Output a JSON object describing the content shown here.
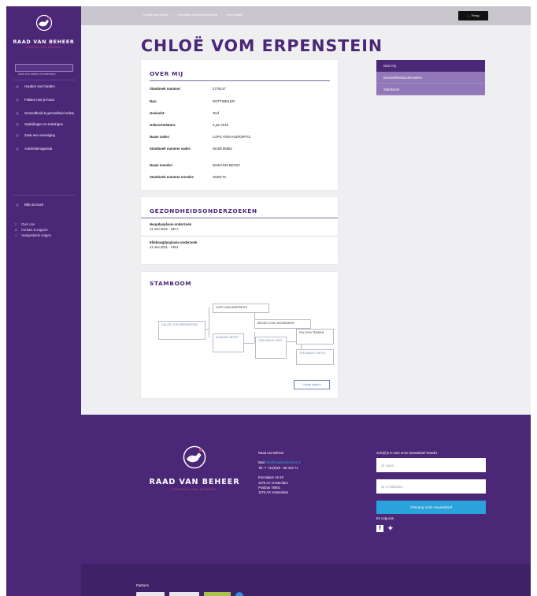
{
  "brand": {
    "name": "RAAD VAN BEHEER",
    "tagline": "HOUDEN VAN HONDEN"
  },
  "search": {
    "placeholder": "Zoek een artikel of onderwerp"
  },
  "nav": {
    "items": [
      {
        "label": "Houden van honden"
      },
      {
        "label": "Fokken met je hond"
      },
      {
        "label": "Gezondheid & gezondheid online"
      },
      {
        "label": "Opleidingen en trainingen"
      },
      {
        "label": "Zoek een vereniging"
      },
      {
        "label": "Activiteitenagenda"
      }
    ],
    "account": "Mijn account",
    "links": [
      {
        "icon": "info-icon",
        "label": "Over ons"
      },
      {
        "icon": "headset-icon",
        "label": "Contact & support"
      },
      {
        "icon": "question-icon",
        "label": "Veelgestelde vragen"
      }
    ]
  },
  "breadcrumb": [
    "Houden van honden",
    "Generaties & gezondheid online",
    "Hond details"
  ],
  "back_label": "Terug",
  "title": "CHLOË VOM ERPENSTEIN",
  "about": {
    "heading": "OVER MIJ",
    "rows": [
      {
        "key": "Stamboek nummer:",
        "value": "2778147"
      },
      {
        "key": "Ras:",
        "value": "ROTTWEILER"
      },
      {
        "key": "Geslacht:",
        "value": "Teef"
      },
      {
        "key": "Geboortedatum:",
        "value": "3 jan 2010"
      },
      {
        "key": "Naam vader:",
        "value": "LUPO VOM AGERSPITZ"
      },
      {
        "key": "Stamboek nummer vader:",
        "value": "DHZB 85852"
      },
      {
        "key": "Naam moeder:",
        "value": "MUNANIS BESSY"
      },
      {
        "key": "Stamboek nummer moeder:",
        "value": "2539178"
      }
    ]
  },
  "health": {
    "heading": "GEZONDHEIDSONDERZOEKEN",
    "exams": [
      {
        "name": "Heupdysplasie onderzoek",
        "result": "11 mei 2011 - HD A"
      },
      {
        "name": "Elleboogdysplasie onderzoek",
        "result": "11 mei 2011 - VRIJ"
      }
    ]
  },
  "pedigree": {
    "heading": "STAMBOOM",
    "nodes": {
      "self": "CHLOË VOM ERPENSTEIN",
      "sire": "LUPO VOM AGERSPITZ",
      "dam": "MUNANIS BESSY",
      "sire_sire": "BRUNO VOM HEIDEBAREN",
      "dam_sire": "TEB WAELE VAYS",
      "g3a": "FAX VON TENDEN",
      "g3b": "TEB WAELE PATCH"
    },
    "next_label": "Vorige pagina"
  },
  "side_menu": [
    {
      "label": "Over mij",
      "active": true
    },
    {
      "label": "Gezondheidsonderzoeken",
      "active": false
    },
    {
      "label": "Stamboom",
      "active": false
    }
  ],
  "footer": {
    "org": "Raad van Beheer",
    "mail_label": "Mail:",
    "mail": "info@raadvanbeheer.nl",
    "phone": "Tel: T +31(0)20 - 66 444 71",
    "address": [
      "Emmalaan 16-18",
      "1075 AV Amsterdam",
      "Postbus 75901",
      "1070 AX Amsterdam"
    ],
    "newsletter_label": "Schrijf je in voor onze nieuwsbrief Reader",
    "name_placeholder": "Je naam",
    "email_placeholder": "Je e-mailadres",
    "subscribe_label": "Ontvang onze nieuwsbrief",
    "follow_label": "En volg ons",
    "partners_label": "Partners"
  },
  "colors": {
    "primary": "#4b2778",
    "accent": "#d4466c",
    "link": "#6a88b8",
    "button": "#2aa2dc"
  }
}
